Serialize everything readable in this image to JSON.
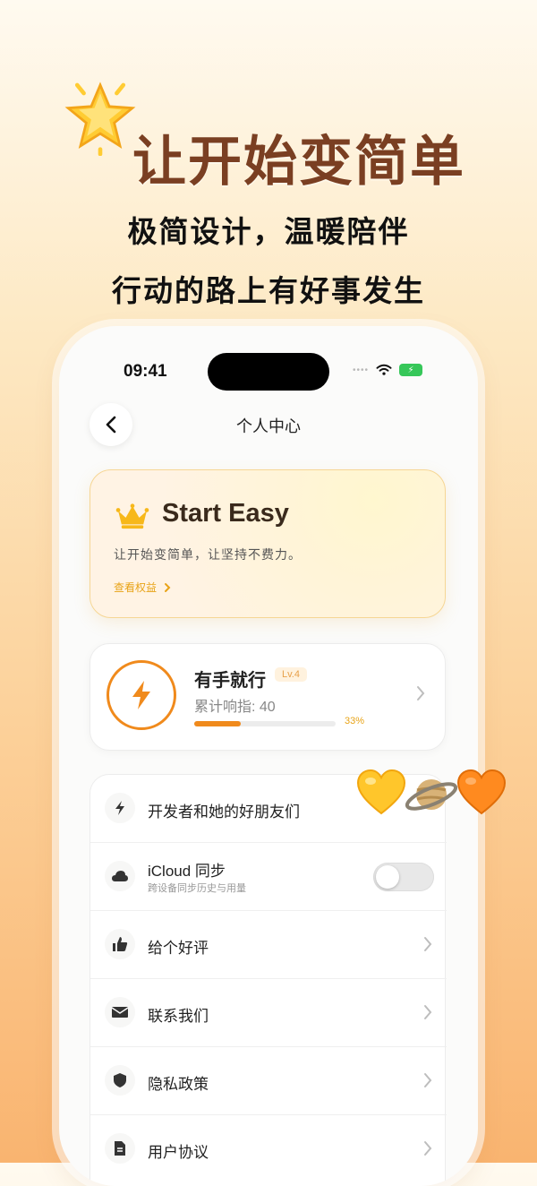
{
  "promo": {
    "headline": "让开始变简单",
    "subtitle_1": "极简设计，温暖陪伴",
    "subtitle_2": "行动的路上有好事发生",
    "decorations": [
      "star-icon",
      "yellow-heart-icon",
      "ringed-planet-icon",
      "orange-heart-icon"
    ]
  },
  "status_bar": {
    "time": "09:41",
    "battery_icon": "charging-battery-icon"
  },
  "nav": {
    "back_icon": "chevron-left-icon",
    "title": "个人中心"
  },
  "vip_card": {
    "icon": "crown-icon",
    "title": "Start Easy",
    "description": "让开始变简单，让坚持不费力。",
    "link": "查看权益"
  },
  "level_card": {
    "icon": "lightning-icon",
    "name": "有手就行",
    "badge": "Lv.4",
    "count_label": "累计响指: 40",
    "progress": 0.33,
    "progress_text": "33%"
  },
  "settings": {
    "items": [
      {
        "icon": "lightning-icon",
        "label": "开发者和她的好朋友们"
      },
      {
        "icon": "cloud-icon",
        "label": "iCloud 同步",
        "sublabel": "跨设备同步历史与用量",
        "toggle": false
      },
      {
        "icon": "thumbs-up-icon",
        "label": "给个好评"
      },
      {
        "icon": "envelope-icon",
        "label": "联系我们"
      },
      {
        "icon": "shield-icon",
        "label": "隐私政策"
      },
      {
        "icon": "document-icon",
        "label": "用户协议"
      }
    ]
  },
  "colors": {
    "accent": "#f08a1c",
    "gold": "#e8a317",
    "headline": "#7a3f22"
  }
}
